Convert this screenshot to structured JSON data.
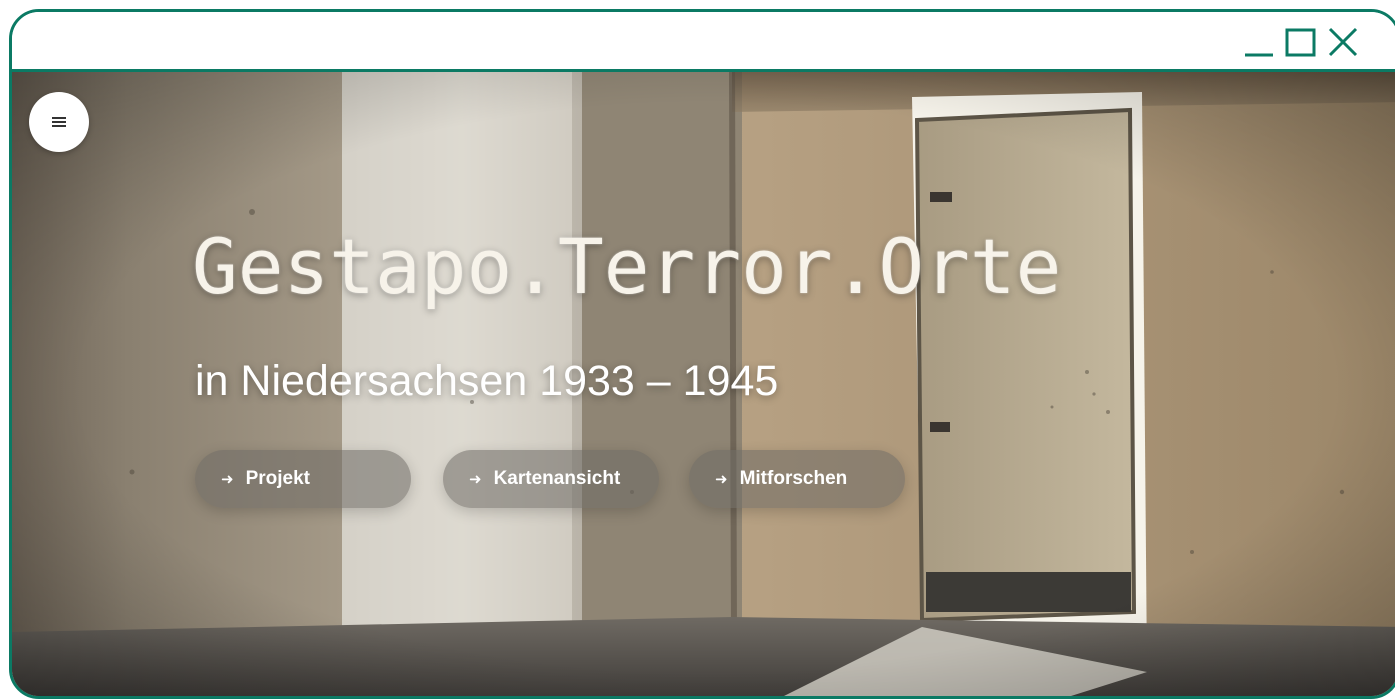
{
  "window": {
    "controls": [
      "minimize-icon",
      "maximize-icon",
      "close-icon"
    ]
  },
  "nav": {
    "menu_icon": "menu-icon"
  },
  "hero": {
    "title": "Gestapo.Terror.Orte",
    "subtitle": "in Niedersachsen 1933 – 1945",
    "buttons": [
      {
        "label": "Projekt",
        "icon": "arrow-right-icon"
      },
      {
        "label": "Kartenansicht",
        "icon": "arrow-right-icon"
      },
      {
        "label": "Mitforschen",
        "icon": "arrow-right-icon"
      }
    ]
  },
  "colors": {
    "frame": "#0b7a64",
    "title_text": "#f7f3ea",
    "button_bg": "#6e6964"
  }
}
